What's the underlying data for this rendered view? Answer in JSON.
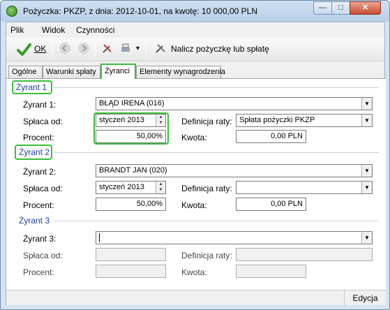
{
  "window": {
    "title": "Pożyczka: PKZP, z dnia: 2012-10-01, na kwotę: 10 000,00 PLN",
    "controls": {
      "minimize": "—",
      "maximize": "□",
      "close": "✕"
    }
  },
  "menu": {
    "items": [
      "Plik",
      "Widok",
      "Czynności"
    ]
  },
  "toolbar": {
    "ok_label": "OK",
    "calculate_label": "Nalicz pożyczkę lub spłatę",
    "dropdown_arrow": "▾"
  },
  "tabs": [
    "Ogólne",
    "Warunki spłaty",
    "Żyranci",
    "Elementy wynagrodzenia"
  ],
  "guarantors": [
    {
      "group_title": "Żyrant 1",
      "label_guarantor": "Żyrant 1:",
      "guarantor_value": "BŁĄD IRENA (016)",
      "label_from": "Spłaca od:",
      "from_value": "styczeń 2013",
      "label_installment": "Definicja raty:",
      "installment_value": "Spłata pożyczki PKZP",
      "label_percent": "Procent:",
      "percent_value": "50,00%",
      "label_amount": "Kwota:",
      "amount_value": "0,00 PLN"
    },
    {
      "group_title": "Żyrant 2",
      "label_guarantor": "Żyrant 2:",
      "guarantor_value": "BRANDT JAN (020)",
      "label_from": "Spłaca od:",
      "from_value": "styczeń 2013",
      "label_installment": "Definicja raty:",
      "installment_value": "",
      "label_percent": "Procent:",
      "percent_value": "50,00%",
      "label_amount": "Kwota:",
      "amount_value": "0,00 PLN"
    },
    {
      "group_title": "Żyrant 3",
      "label_guarantor": "Żyrant 3:",
      "guarantor_value": "",
      "label_from": "Spłaca od:",
      "from_value": "",
      "label_installment": "Definicja raty:",
      "installment_value": "",
      "label_percent": "Procent:",
      "percent_value": "",
      "label_amount": "Kwota:",
      "amount_value": ""
    }
  ],
  "status": {
    "mode": "Edycja"
  },
  "colors": {
    "highlight": "#3bbd3b",
    "group_title": "#1c3f9e"
  }
}
